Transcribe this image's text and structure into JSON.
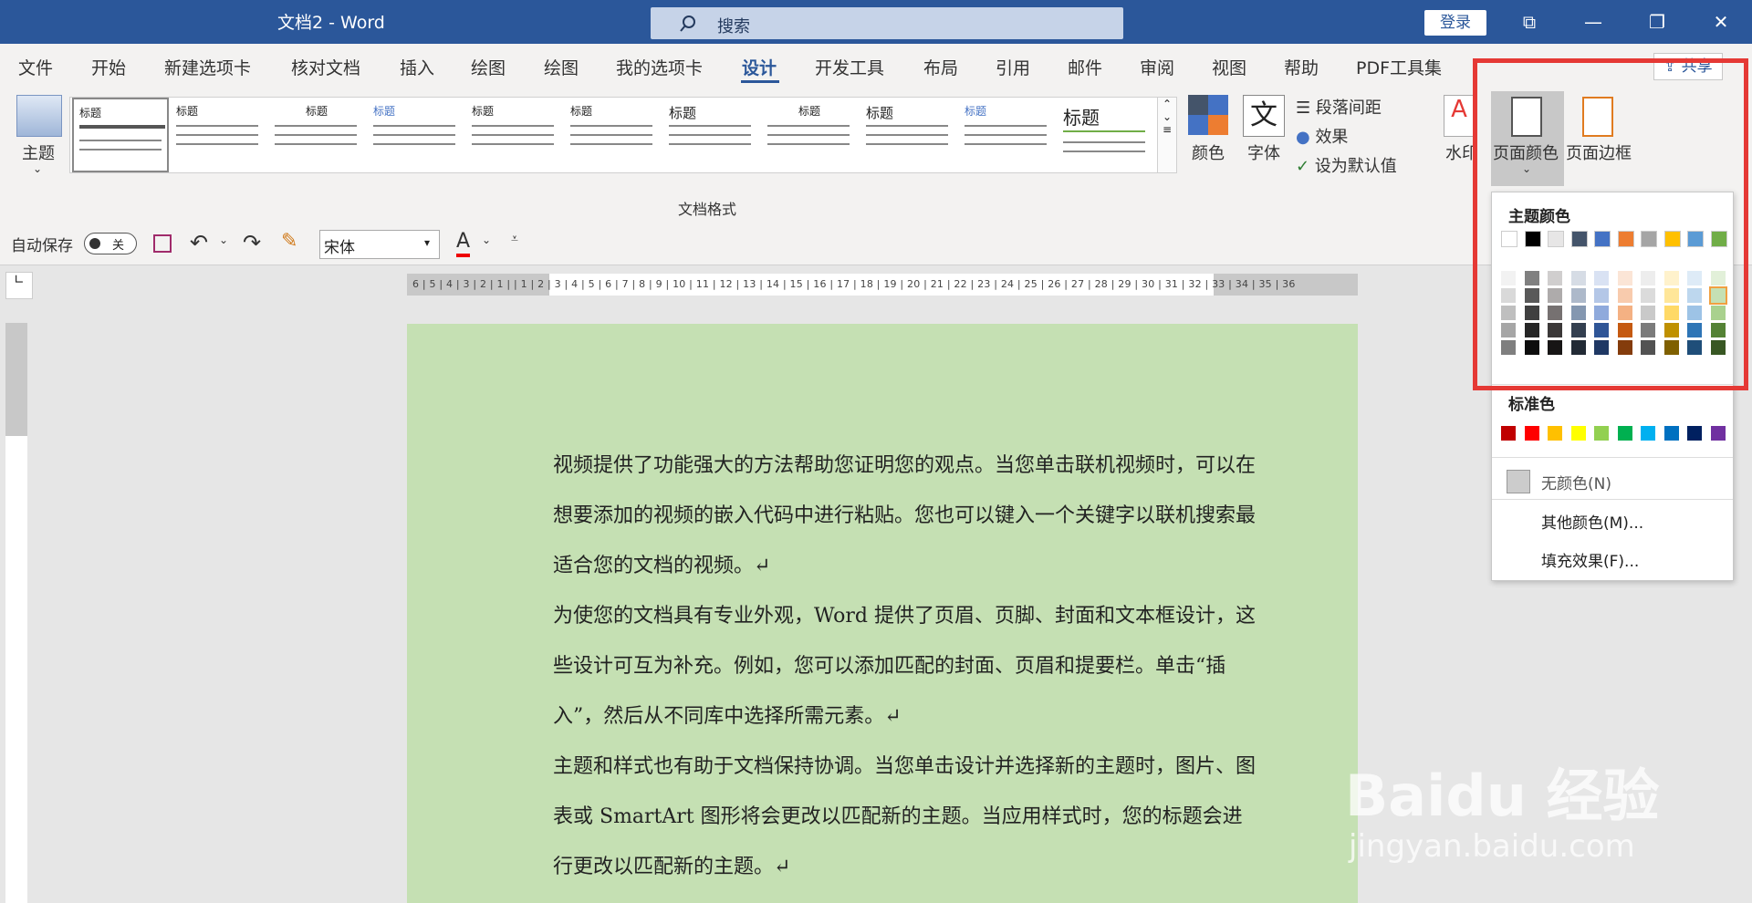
{
  "window": {
    "title": "文档2 - Word",
    "login": "登录",
    "share": "共享"
  },
  "search": {
    "placeholder": "搜索"
  },
  "tabs": [
    "文件",
    "开始",
    "新建选项卡",
    "核对文档",
    "插入",
    "绘图",
    "绘图",
    "我的选项卡",
    "设计",
    "开发工具",
    "布局",
    "引用",
    "邮件",
    "审阅",
    "视图",
    "帮助",
    "PDF工具集"
  ],
  "active_tab": "设计",
  "ribbon": {
    "theme_label": "主题",
    "group_label": "文档格式",
    "style_thumbs": [
      "标题",
      "标题",
      "标题",
      "标题",
      "标题",
      "标题",
      "标题",
      "标题",
      "标题",
      "标题",
      "标题"
    ],
    "colors_label": "颜色",
    "fonts_label": "字体",
    "fonts_glyph": "文",
    "para_spacing": "段落间距",
    "effects": "效果",
    "set_default": "设为默认值",
    "watermark": "水印",
    "page_color": "页面颜色",
    "page_border": "页面边框"
  },
  "quickbar": {
    "autosave_label": "自动保存",
    "autosave_state": "关",
    "font_name": "宋体",
    "font_color_letter": "A"
  },
  "ruler": {
    "horizontal": "6 | 5 | 4 | 3 | 2 | 1 |  | 1 | 2 | 3 | 4 | 5 | 6 | 7 | 8 | 9 | 10 | 11 | 12 | 13 | 14 | 15 | 16 | 17 | 18 | 19 | 20 | 21 | 22 | 23 | 24 | 25 | 26 | 27 | 28 | 29 | 30 | 31 | 32 | 33 | 34 | 35 | 36"
  },
  "document": {
    "page_color": "#c5e0b3",
    "paragraphs": [
      "视频提供了功能强大的方法帮助您证明您的观点。当您单击联机视频时，可以在想要添加的视频的嵌入代码中进行粘贴。您也可以键入一个关键字以联机搜索最适合您的文档的视频。↵",
      "为使您的文档具有专业外观，Word 提供了页眉、页脚、封面和文本框设计，这些设计可互为补充。例如，您可以添加匹配的封面、页眉和提要栏。单击“插入”，然后从不同库中选择所需元素。↵",
      "主题和样式也有助于文档保持协调。当您单击设计并选择新的主题时，图片、图表或 SmartArt 图形将会更改以匹配新的主题。当应用样式时，您的标题会进行更改以匹配新的主题。↵"
    ]
  },
  "color_menu": {
    "theme_colors_title": "主题颜色",
    "theme_top_row": [
      "#ffffff",
      "#000000",
      "#e7e6e6",
      "#44546a",
      "#4472c4",
      "#ed7d31",
      "#a5a5a5",
      "#ffc000",
      "#5b9bd5",
      "#70ad47"
    ],
    "theme_shades": [
      [
        "#f2f2f2",
        "#808080",
        "#d0cece",
        "#d6dce5",
        "#d9e2f3",
        "#fbe5d6",
        "#ededed",
        "#fff2cc",
        "#deebf7",
        "#e2f0d9"
      ],
      [
        "#d9d9d9",
        "#595959",
        "#aeabab",
        "#adb9ca",
        "#b4c7e7",
        "#f8cbad",
        "#dbdbdb",
        "#ffe699",
        "#bdd7ee",
        "#c5e0b4"
      ],
      [
        "#bfbfbf",
        "#404040",
        "#767171",
        "#8497b0",
        "#8faadc",
        "#f4b183",
        "#c9c9c9",
        "#ffd966",
        "#9dc3e6",
        "#a9d18e"
      ],
      [
        "#a6a6a6",
        "#262626",
        "#3b3838",
        "#333f50",
        "#2f5597",
        "#c55a11",
        "#7b7b7b",
        "#bf9000",
        "#2e75b6",
        "#548235"
      ],
      [
        "#7f7f7f",
        "#0d0d0d",
        "#171515",
        "#222a35",
        "#1f3864",
        "#843c0c",
        "#525252",
        "#7f6000",
        "#1f4e79",
        "#385723"
      ]
    ],
    "standard_colors_title": "标准色",
    "standard_colors": [
      "#c00000",
      "#ff0000",
      "#ffc000",
      "#ffff00",
      "#92d050",
      "#00b050",
      "#00b0f0",
      "#0070c0",
      "#002060",
      "#7030a0"
    ],
    "no_color": "无颜色(N)",
    "more_colors": "其他颜色(M)...",
    "fill_effects": "填充效果(F)..."
  },
  "watermark_text": "Baidu 经验",
  "watermark_sub": "jingyan.baidu.com",
  "accent_color": "#2b579a",
  "highlight_color": "#e53935"
}
